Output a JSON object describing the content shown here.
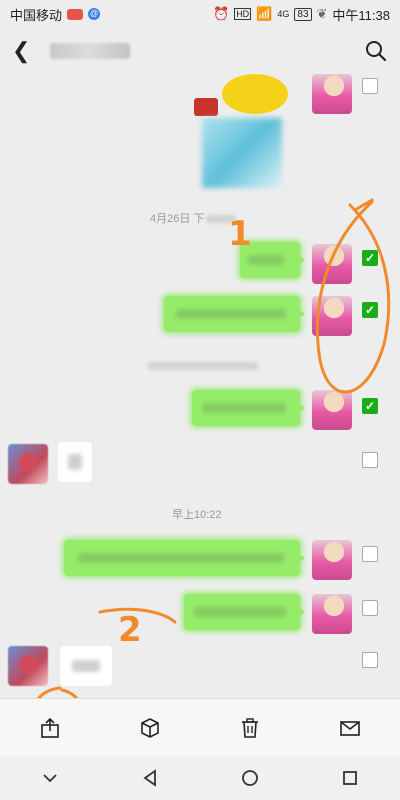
{
  "status_bar": {
    "carrier": "中国移动",
    "network": "4G",
    "battery": "83",
    "time": "中午11:38"
  },
  "header": {
    "back_icon": "chevron-left-icon",
    "search_icon": "search-icon"
  },
  "chat": {
    "timestamps": {
      "t1_visible": "4月26日 下",
      "t3": "早上10:22"
    },
    "selection": [
      false,
      true,
      true,
      true,
      false,
      false,
      false,
      false
    ],
    "accent": "#1aad19",
    "bubble_color": "#95ec69"
  },
  "annotations": {
    "mark1": "1",
    "mark2": "2",
    "color": "#f08a2a"
  },
  "toolbar": {
    "items": [
      "share-icon",
      "box-icon",
      "trash-icon",
      "mail-icon"
    ]
  },
  "navbar": {
    "items": [
      "chevron-down-icon",
      "back-triangle-icon",
      "home-circle-icon",
      "recent-square-icon"
    ]
  }
}
